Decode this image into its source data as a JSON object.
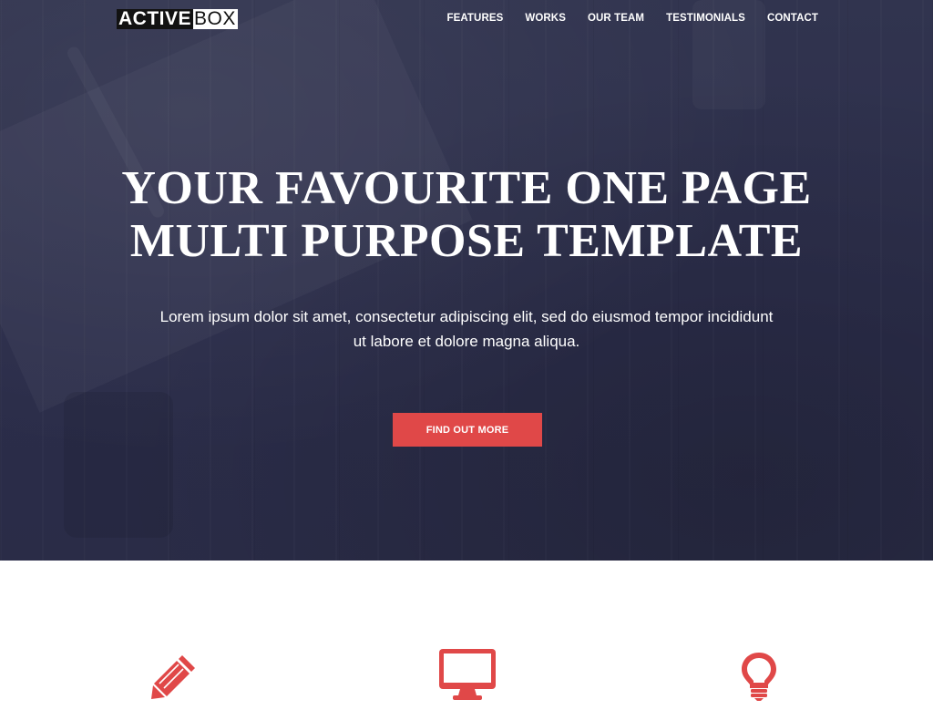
{
  "brand": {
    "logo_part_1": "ACTIVE",
    "logo_part_2": "BOX"
  },
  "nav": {
    "items": [
      {
        "label": "FEATURES"
      },
      {
        "label": "WORKS"
      },
      {
        "label": "OUR TEAM"
      },
      {
        "label": "TESTIMONIALS"
      },
      {
        "label": "CONTACT"
      }
    ]
  },
  "hero": {
    "title_line_1": "YOUR FAVOURITE ONE PAGE",
    "title_line_2": "MULTI PURPOSE TEMPLATE",
    "subtitle": "Lorem ipsum dolor sit amet, consectetur adipiscing elit, sed do eiusmod tempor incididunt ut labore et dolore magna aliqua.",
    "cta_label": "FIND OUT MORE"
  },
  "features": {
    "icons": [
      "pencil-icon",
      "monitor-icon",
      "lightbulb-icon"
    ]
  },
  "colors": {
    "hero_background": "#2c2e4d",
    "accent": "#e04848",
    "text_light": "#ffffff"
  }
}
